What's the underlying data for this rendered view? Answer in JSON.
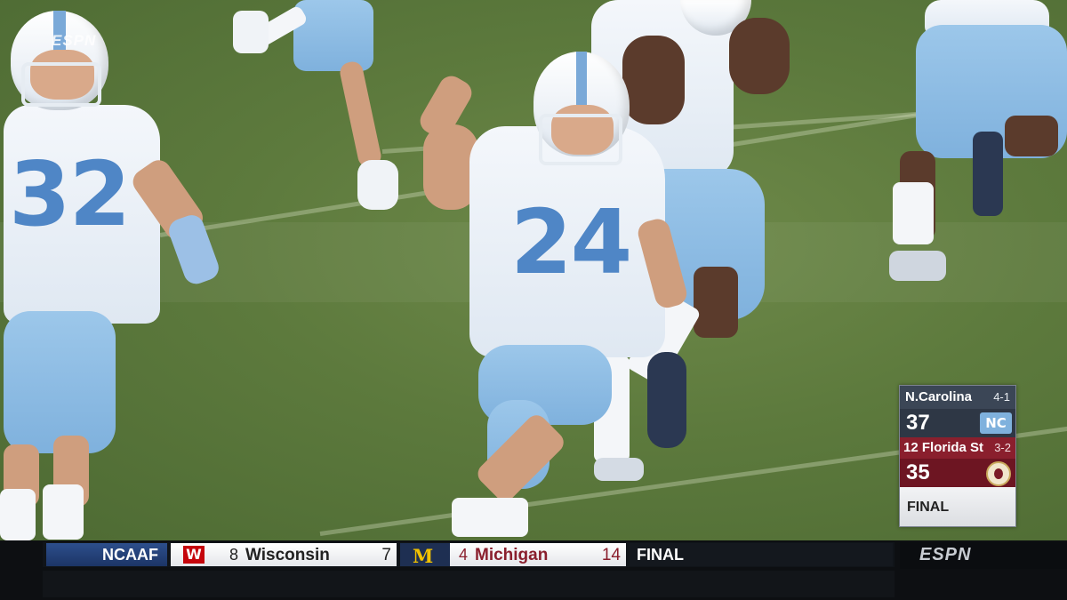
{
  "broadcast": {
    "network": "ESPN"
  },
  "scorebox": {
    "team1": {
      "name": "N.Carolina",
      "record": "4-1",
      "score": "37",
      "logo": "NC"
    },
    "team2": {
      "rank": "12",
      "name": "Florida St",
      "record": "3-2",
      "score": "35"
    },
    "status": "FINAL"
  },
  "ticker": {
    "league": "NCAAF",
    "game": {
      "away": {
        "rank": "8",
        "name": "Wisconsin",
        "score": "7",
        "logo": "W"
      },
      "home": {
        "rank": "4",
        "name": "Michigan",
        "score": "14",
        "logo": "M"
      },
      "status": "FINAL"
    },
    "network_logo": "ESPN"
  },
  "players": [
    {
      "number": "32"
    },
    {
      "number": "24"
    }
  ],
  "colors": {
    "unc_blue": "#7fb1dd",
    "fsu_garnet": "#8a1f2d",
    "michigan_maize": "#f2c200",
    "wisconsin_red": "#c5050c"
  }
}
